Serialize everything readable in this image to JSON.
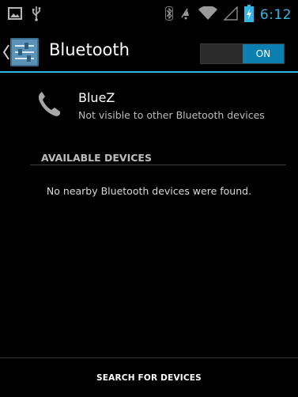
{
  "status_bar": {
    "time": "6:12",
    "accent_color": "#33b5e5",
    "icons": [
      "image-icon",
      "usb-icon",
      "bluetooth-icon",
      "mute-icon",
      "wifi-icon",
      "signal-icon",
      "battery-charging-icon"
    ]
  },
  "action_bar": {
    "title": "Bluetooth",
    "toggle_label": "ON",
    "toggle_color": "#0a7fb0"
  },
  "paired_device": {
    "name": "BlueZ",
    "subtitle": "Not visible to other Bluetooth devices",
    "icon": "phone-icon"
  },
  "available_devices": {
    "header": "AVAILABLE DEVICES",
    "empty_message": "No nearby Bluetooth devices were found."
  },
  "footer": {
    "search_label": "SEARCH FOR DEVICES"
  }
}
